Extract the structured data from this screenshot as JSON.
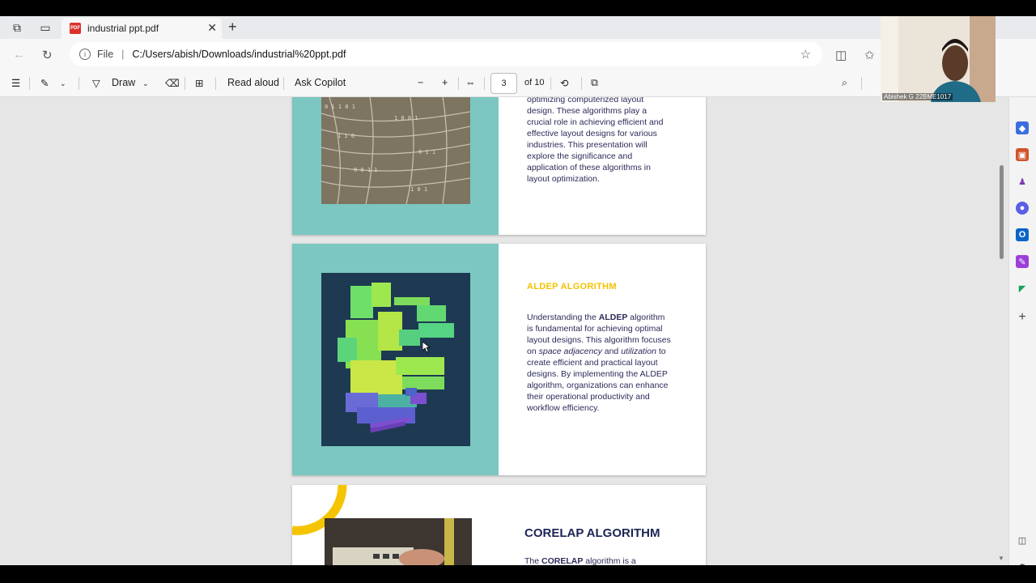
{
  "browser": {
    "tab_title": "industrial ppt.pdf",
    "pdf_badge": "PDF",
    "address_prefix": "File",
    "address_url": "C:/Users/abish/Downloads/industrial%20ppt.pdf"
  },
  "toolbar": {
    "draw_label": "Draw",
    "read_aloud_label": "Read aloud",
    "copilot_label": "Ask Copilot",
    "page_current": "3",
    "page_total": "of 10"
  },
  "slide1": {
    "text": "optimizing computerized layout design. These algorithms play a crucial role in achieving efficient and effective layout designs for various industries. This presentation will explore the significance and application of these algorithms in layout optimization."
  },
  "slide2": {
    "title": "ALDEP ALGORITHM",
    "p_1": "Understanding the ",
    "p_bold": "ALDEP",
    "p_2": " algorithm is fundamental for achieving optimal layout designs. This algorithm focuses on ",
    "p_it1": "space adjacency",
    "p_3": " and ",
    "p_it2": "utilization",
    "p_4": " to create efficient and practical layout designs. By implementing the ALDEP algorithm, organizations can enhance their operational productivity and workflow efficiency."
  },
  "slide3": {
    "title": "CORELAP ALGORITHM",
    "p_1": "The ",
    "p_bold": "CORELAP",
    "p_2": " algorithm is a"
  },
  "webcam": {
    "label": "Abishek G 22BME1017"
  },
  "colors": {
    "teal": "#7cc7c1",
    "aldep_title": "#f2c200",
    "navy": "#1d2456",
    "yellow_arc": "#f5c400"
  }
}
